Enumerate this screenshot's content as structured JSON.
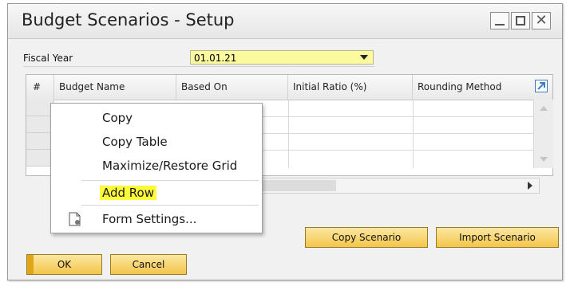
{
  "window": {
    "title": "Budget Scenarios - Setup"
  },
  "fiscal_year": {
    "label": "Fiscal Year",
    "value": "01.01.21"
  },
  "grid": {
    "headers": [
      "#",
      "Budget Name",
      "Based On",
      "Initial Ratio (%)",
      "Rounding Method"
    ],
    "expand_icon": "expand-arrow-icon"
  },
  "context_menu": {
    "items": [
      "Copy",
      "Copy Table",
      "Maximize/Restore Grid",
      "Add Row",
      "Form Settings..."
    ],
    "highlight_color": "#fdfb3a"
  },
  "buttons": {
    "copy_scenario": "Copy Scenario",
    "import_scenario": "Import Scenario",
    "ok": "OK",
    "cancel": "Cancel"
  },
  "colors": {
    "accent": "#f3c64a",
    "field_bg": "#fbfa9e"
  }
}
